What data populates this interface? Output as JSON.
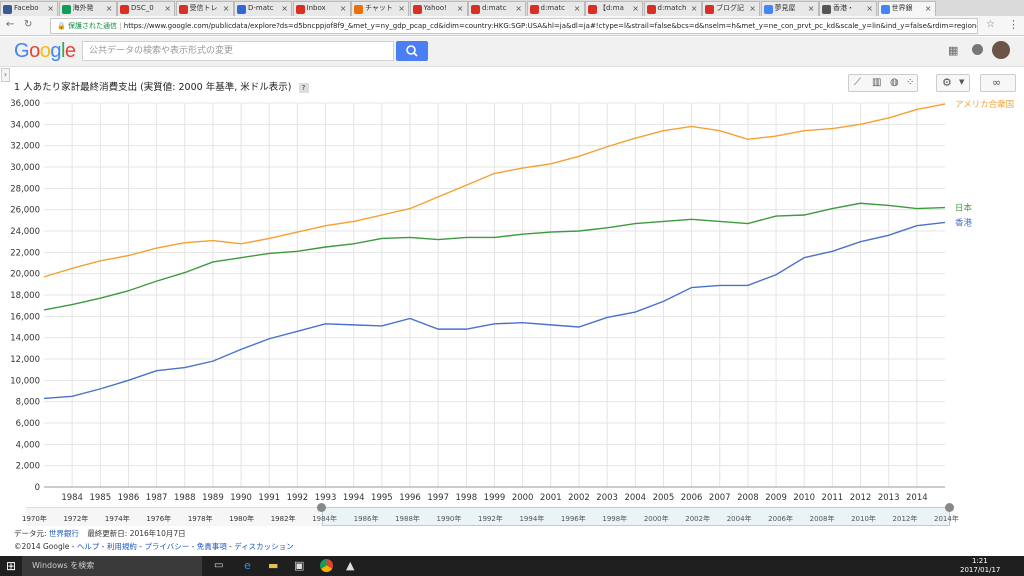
{
  "browser": {
    "tabs": [
      {
        "label": "Facebo",
        "color": "#3b5998"
      },
      {
        "label": "海外発",
        "color": "#0f9d58"
      },
      {
        "label": "DSC_0",
        "color": "#d93025"
      },
      {
        "label": "受信トレ",
        "color": "#d93025"
      },
      {
        "label": "D-matc",
        "color": "#3367d6"
      },
      {
        "label": "Inbox",
        "color": "#d93025"
      },
      {
        "label": "チャット",
        "color": "#e8710a"
      },
      {
        "label": "Yahoo!",
        "color": "#d93025"
      },
      {
        "label": "d:matc",
        "color": "#d93025"
      },
      {
        "label": "d:matc",
        "color": "#d93025"
      },
      {
        "label": "【d:ma",
        "color": "#d93025"
      },
      {
        "label": "d:match",
        "color": "#d93025"
      },
      {
        "label": "ブログ記",
        "color": "#d93025"
      },
      {
        "label": "夢見屋",
        "color": "#4285f4"
      },
      {
        "label": "香港・",
        "color": "#555555"
      },
      {
        "label": "世界銀",
        "color": "#4285f4"
      }
    ],
    "secure_label": "保護された通信",
    "url": "https://www.google.com/publicdata/explore?ds=d5bncppjof8f9_&met_y=ny_gdp_pcap_cd&idim=country:HKG:SGP:USA&hl=ja&dl=ja#!ctype=l&strail=false&bcs=d&nselm=h&met_y=ne_con_prvt_pc_kd&scale_y=lin&ind_y=false&rdim=region&idim=country"
  },
  "header": {
    "logo": "Google",
    "search_placeholder": "公共データの検索や表示形式の変更"
  },
  "chart_title": "1 人あたり家計最終消費支出 (実質値: 2000 年基準, 米ドル表示)",
  "help_label": "?",
  "chart_data": {
    "type": "line",
    "title": "1 人あたり家計最終消費支出 (実質値: 2000 年基準, 米ドル表示)",
    "ylim": [
      0,
      36000
    ],
    "yticks": [
      0,
      2000,
      4000,
      6000,
      8000,
      10000,
      12000,
      14000,
      16000,
      18000,
      20000,
      22000,
      24000,
      26000,
      28000,
      30000,
      32000,
      34000,
      36000
    ],
    "ytick_labels": [
      "0",
      "2,000",
      "4,000",
      "6,000",
      "8,000",
      "10,000",
      "12,000",
      "14,000",
      "16,000",
      "18,000",
      "20,000",
      "22,000",
      "24,000",
      "26,000",
      "28,000",
      "30,000",
      "32,000",
      "34,000",
      "36,000"
    ],
    "x": [
      1983,
      1984,
      1985,
      1986,
      1987,
      1988,
      1989,
      1990,
      1991,
      1992,
      1993,
      1994,
      1995,
      1996,
      1997,
      1998,
      1999,
      2000,
      2001,
      2002,
      2003,
      2004,
      2005,
      2006,
      2007,
      2008,
      2009,
      2010,
      2011,
      2012,
      2013,
      2014,
      2015
    ],
    "xtick_labels": [
      "1984",
      "1985",
      "1986",
      "1987",
      "1988",
      "1989",
      "1990",
      "1991",
      "1992",
      "1993",
      "1994",
      "1995",
      "1996",
      "1997",
      "1998",
      "1999",
      "2000",
      "2001",
      "2002",
      "2003",
      "2004",
      "2005",
      "2006",
      "2007",
      "2008",
      "2009",
      "2010",
      "2011",
      "2012",
      "2013",
      "2014"
    ],
    "grid": true,
    "series": [
      {
        "name": "アメリカ合衆国",
        "color": "#f4a133",
        "values": [
          19700,
          20500,
          21200,
          21700,
          22400,
          22900,
          23100,
          22800,
          23300,
          23900,
          24500,
          24900,
          25500,
          26100,
          27200,
          28300,
          29400,
          29900,
          30300,
          31000,
          31900,
          32700,
          33400,
          33800,
          33400,
          32600,
          32900,
          33400,
          33600,
          34000,
          34600,
          35400,
          35900
        ]
      },
      {
        "name": "日本",
        "color": "#3d9a3d",
        "values": [
          16600,
          17100,
          17700,
          18400,
          19300,
          20100,
          21100,
          21500,
          21900,
          22100,
          22500,
          22800,
          23300,
          23400,
          23200,
          23400,
          23400,
          23700,
          23900,
          24000,
          24300,
          24700,
          24900,
          25100,
          24900,
          24700,
          25400,
          25500,
          26100,
          26600,
          26400,
          26100,
          26200
        ]
      },
      {
        "name": "香港",
        "color": "#4a72c9",
        "values": [
          8300,
          8500,
          9200,
          10000,
          10900,
          11200,
          11800,
          12900,
          13900,
          14600,
          15300,
          15200,
          15100,
          15800,
          14800,
          14800,
          15300,
          15400,
          15200,
          15000,
          15900,
          16400,
          17400,
          18700,
          18900,
          18900,
          19900,
          21500,
          22100,
          23000,
          23600,
          24500,
          24800
        ]
      }
    ]
  },
  "timeline": {
    "labels": [
      "1970年",
      "1972年",
      "1974年",
      "1976年",
      "1978年",
      "1980年",
      "1982年",
      "1984年",
      "1986年",
      "1988年",
      "1990年",
      "1992年",
      "1994年",
      "1996年",
      "1998年",
      "2000年",
      "2002年",
      "2004年",
      "2006年",
      "2008年",
      "2010年",
      "2012年",
      "2014年"
    ]
  },
  "footer": {
    "source_label": "データ元:",
    "source_link": "世界銀行",
    "updated": "最終更新日: 2016年10月7日",
    "copyright": "©2014 Google",
    "links": [
      "ヘルプ",
      "利用規約",
      "プライバシー",
      "免責事項",
      "ディスカッション"
    ]
  },
  "taskbar": {
    "search_placeholder": "Windows を検索",
    "time": "1:21",
    "date": "2017/01/17"
  }
}
